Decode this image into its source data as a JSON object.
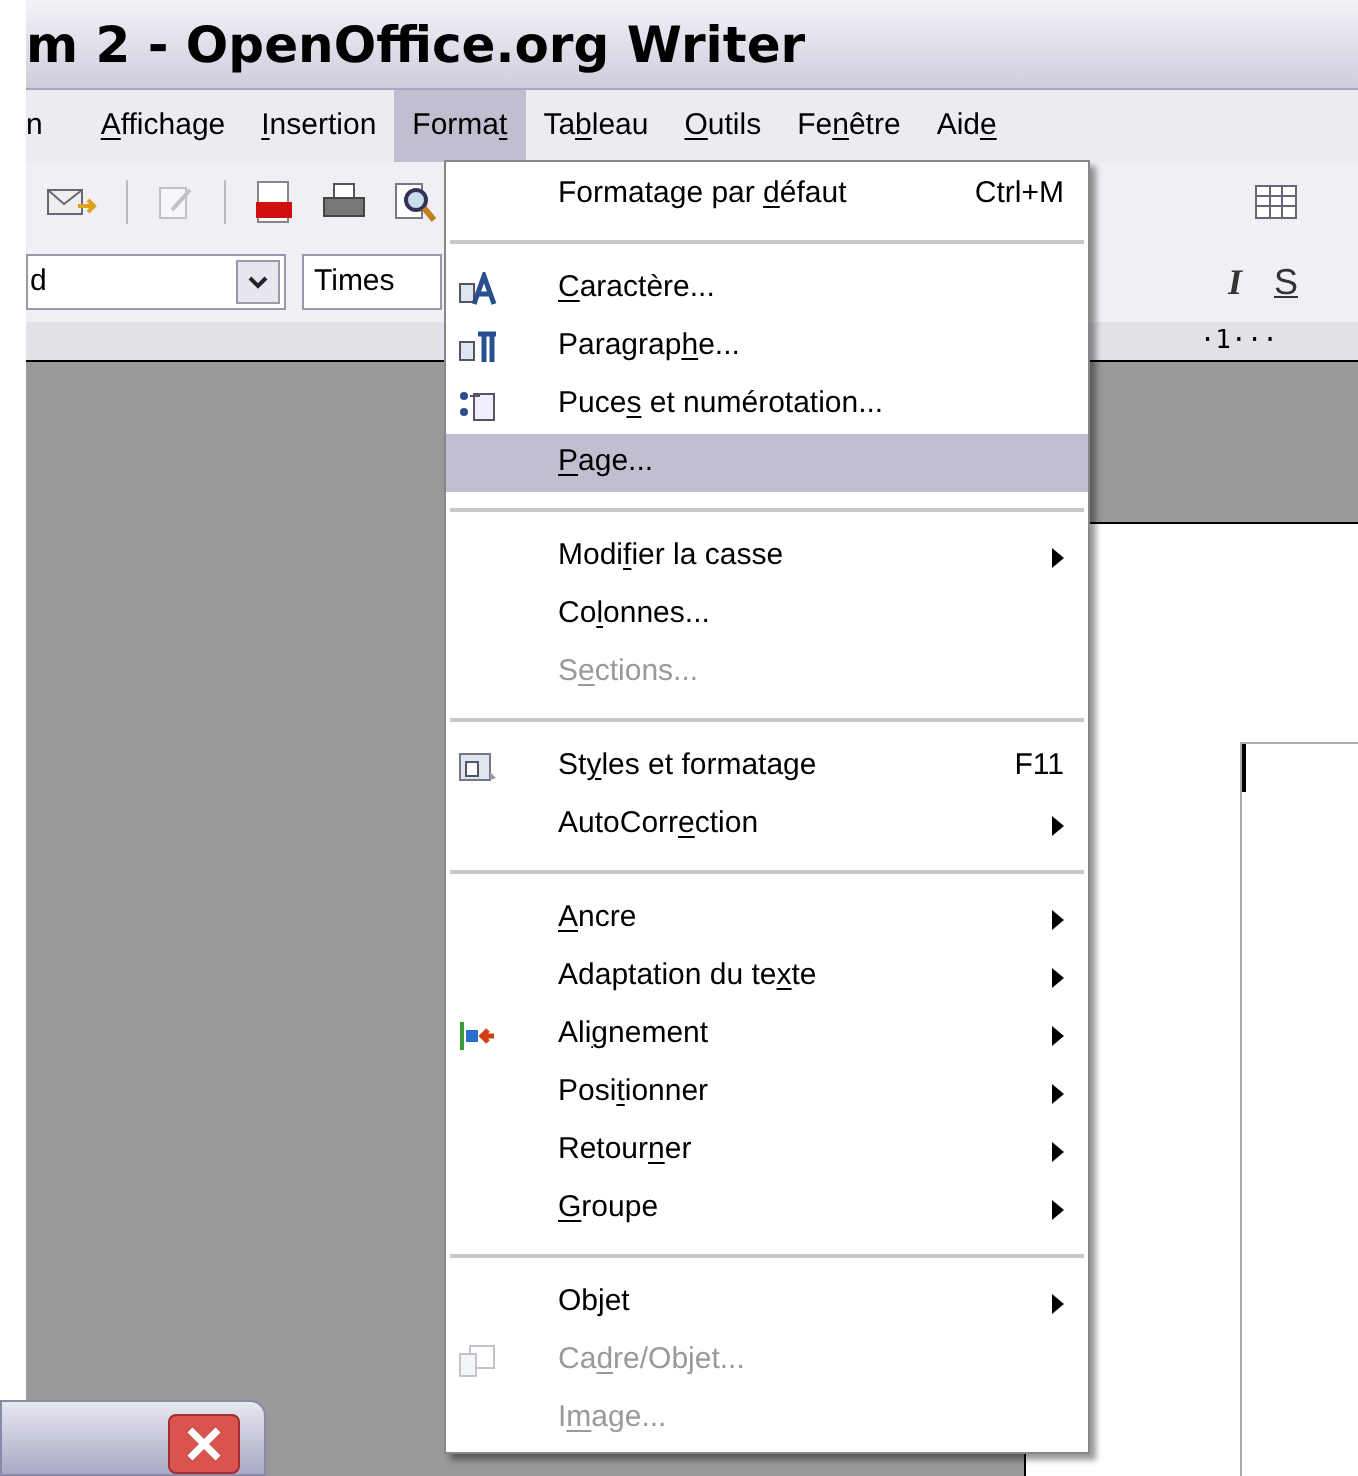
{
  "window": {
    "title": "m 2 - OpenOffice.org Writer"
  },
  "menu_bar": [
    {
      "before": "n",
      "selected": false
    },
    {
      "key": "A",
      "after": "ffichage",
      "selected": false
    },
    {
      "key": "I",
      "after": "nsertion",
      "selected": false
    },
    {
      "before": "Forma",
      "key": "t",
      "selected": true
    },
    {
      "before": "Ta",
      "key": "b",
      "after": "leau",
      "selected": false
    },
    {
      "key": "O",
      "after": "utils",
      "selected": false
    },
    {
      "before": "Fe",
      "key": "n",
      "after": "être",
      "selected": false
    },
    {
      "before": "Aid",
      "key": "e",
      "selected": false
    }
  ],
  "formatting_toolbar": {
    "style_value": "d",
    "font_value": "Times",
    "buttons": [
      "I",
      "S"
    ]
  },
  "ruler": {
    "text": "·1···"
  },
  "format_menu": [
    {
      "kind": "item",
      "before": "Formatage par ",
      "key": "d",
      "after": "éfaut",
      "shortcut": "Ctrl+M",
      "submenu": false,
      "disabled": false,
      "selected": false
    },
    {
      "kind": "separator"
    },
    {
      "kind": "item",
      "key": "C",
      "after": "aractère...",
      "submenu": false,
      "disabled": false,
      "selected": false
    },
    {
      "kind": "item",
      "before": "Paragrap",
      "key": "h",
      "after": "e...",
      "submenu": false,
      "disabled": false,
      "selected": false
    },
    {
      "kind": "item",
      "before": "Puce",
      "key": "s",
      "after": " et numérotation...",
      "submenu": false,
      "disabled": false,
      "selected": false
    },
    {
      "kind": "item",
      "key": "P",
      "after": "age...",
      "submenu": false,
      "disabled": false,
      "selected": true
    },
    {
      "kind": "separator"
    },
    {
      "kind": "item",
      "before": "Modi",
      "key": "f",
      "after": "ier la casse",
      "submenu": true,
      "disabled": false,
      "selected": false
    },
    {
      "kind": "item",
      "before": "Co",
      "key": "l",
      "after": "onnes...",
      "submenu": false,
      "disabled": false,
      "selected": false
    },
    {
      "kind": "item",
      "before": "S",
      "key": "e",
      "after": "ctions...",
      "submenu": false,
      "disabled": true,
      "selected": false
    },
    {
      "kind": "separator"
    },
    {
      "kind": "item",
      "before": "St",
      "key": "y",
      "after": "les et formatage",
      "shortcut": "F11",
      "submenu": false,
      "disabled": false,
      "selected": false
    },
    {
      "kind": "item",
      "before": "AutoCorr",
      "key": "e",
      "after": "ction",
      "submenu": true,
      "disabled": false,
      "selected": false
    },
    {
      "kind": "separator"
    },
    {
      "kind": "item",
      "key": "A",
      "after": "ncre",
      "submenu": true,
      "disabled": false,
      "selected": false
    },
    {
      "kind": "item",
      "before": "Adaptation du te",
      "key": "x",
      "after": "te",
      "submenu": true,
      "disabled": false,
      "selected": false
    },
    {
      "kind": "item",
      "before": "Ali",
      "key": "g",
      "after": "nement",
      "submenu": true,
      "disabled": false,
      "selected": false
    },
    {
      "kind": "item",
      "before": "Posi",
      "key": "t",
      "after": "ionner",
      "submenu": true,
      "disabled": false,
      "selected": false
    },
    {
      "kind": "item",
      "before": "Retour",
      "key": "n",
      "after": "er",
      "submenu": true,
      "disabled": false,
      "selected": false
    },
    {
      "kind": "item",
      "key": "G",
      "after": "roupe",
      "submenu": true,
      "disabled": false,
      "selected": false
    },
    {
      "kind": "separator"
    },
    {
      "kind": "item",
      "before": "Objet",
      "submenu": true,
      "disabled": false,
      "selected": false
    },
    {
      "kind": "item",
      "before": "Ca",
      "key": "d",
      "after": "re/Objet...",
      "submenu": false,
      "disabled": true,
      "selected": false
    },
    {
      "kind": "item",
      "before": "I",
      "key": "m",
      "after": "age...",
      "submenu": false,
      "disabled": true,
      "selected": false
    }
  ]
}
